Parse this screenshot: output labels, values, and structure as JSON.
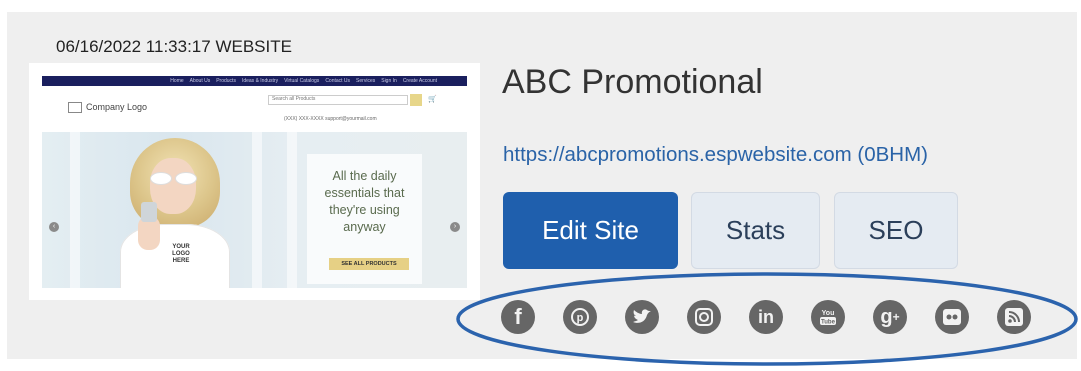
{
  "entry": {
    "timestamp": "06/16/2022 11:33:17 WEBSITE",
    "site_name": "ABC Promotional",
    "site_url": "https://abcpromotions.espwebsite.com (0BHM)"
  },
  "thumbnail": {
    "nav_items": [
      "Home",
      "About Us",
      "Products",
      "Ideas & Industry",
      "Virtual Catalogs",
      "Contact Us",
      "Services",
      "Sign In",
      "Create Account"
    ],
    "logo_text": "Company Logo",
    "search_placeholder": "Search all Products",
    "contact_text": "(XXX) XXX-XXXX   support@yourmail.com",
    "shirt_logo": "YOUR LOGO HERE",
    "hero_text": "All the daily essentials that they're using anyway",
    "hero_button": "SEE ALL PRODUCTS",
    "prev_arrow": "‹",
    "next_arrow": "›"
  },
  "buttons": {
    "edit_site": "Edit Site",
    "stats": "Stats",
    "seo": "SEO"
  },
  "social_icons": [
    {
      "name": "facebook-icon",
      "glyph": "f"
    },
    {
      "name": "pinterest-icon",
      "glyph": "p"
    },
    {
      "name": "twitter-icon",
      "glyph": "t"
    },
    {
      "name": "instagram-icon",
      "glyph": "◘"
    },
    {
      "name": "linkedin-icon",
      "glyph": "in"
    },
    {
      "name": "youtube-icon",
      "glyph": "You"
    },
    {
      "name": "google-plus-icon",
      "glyph": "g+"
    },
    {
      "name": "flickr-icon",
      "glyph": "••"
    },
    {
      "name": "rss-icon",
      "glyph": "≈"
    }
  ],
  "colors": {
    "card_background": "#efefef",
    "primary_button": "#1f5fad",
    "secondary_button": "#e5ebf2",
    "url_link": "#2a63a7",
    "social_icon": "#666666",
    "highlight_oval": "#2b63ad"
  }
}
